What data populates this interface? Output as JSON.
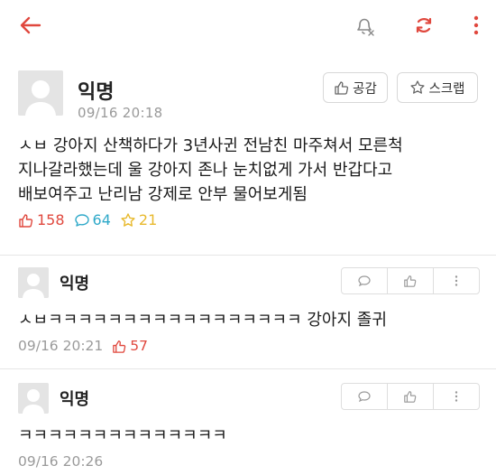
{
  "header": {
    "back_icon": "arrow-left-icon",
    "notify_icon": "bell-off-icon",
    "refresh_icon": "refresh-icon",
    "more_icon": "more-vertical-icon",
    "accent": "#e0483e"
  },
  "post": {
    "author": "익명",
    "date": "09/16 20:18",
    "like_button": "공감",
    "scrap_button": "스크랩",
    "text": "ㅅㅂ 강아지 산책하다가 3년사귄 전남친 마주쳐서 모른척\n지나갈라했는데 울 강아지 존나 눈치없게 가서 반갑다고\n배보여주고 난리남 강제로 안부 물어보게됨",
    "likes": "158",
    "comments": "64",
    "scraps": "21"
  },
  "comments": [
    {
      "author": "익명",
      "text": "ㅅㅂㅋㅋㅋㅋㅋㅋㅋㅋㅋㅋㅋㅋㅋㅋㅋㅋㅋ 강아지 졸귀",
      "date": "09/16 20:21",
      "likes": "57"
    },
    {
      "author": "익명",
      "text": "ㅋㅋㅋㅋㅋㅋㅋㅋㅋㅋㅋㅋㅋㅋ",
      "date": "09/16 20:26",
      "likes": ""
    }
  ]
}
